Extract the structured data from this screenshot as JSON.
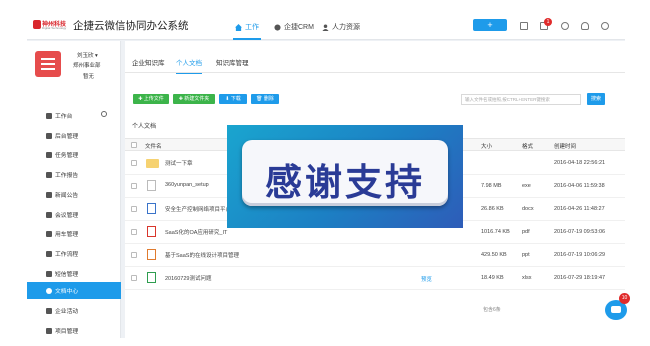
{
  "app": {
    "brand_cn": "神州科技",
    "brand_en": "Digital Technology",
    "title": "企捷云微信协同办公系统"
  },
  "nav": {
    "tabs": [
      {
        "label": "工作",
        "icon": "home-icon"
      },
      {
        "label": "企捷CRM",
        "icon": "crm-icon"
      },
      {
        "label": "人力资源",
        "icon": "people-icon"
      }
    ],
    "plus_label": "+",
    "notification_count": "1"
  },
  "user": {
    "name": "刘玉欣 ▾",
    "dept": "郑州事业部",
    "role": "暂无"
  },
  "sidebar": {
    "items": [
      {
        "label": "工作台"
      },
      {
        "label": "后台管理"
      },
      {
        "label": "任务管理"
      },
      {
        "label": "工作报告"
      },
      {
        "label": "新闻公告"
      },
      {
        "label": "会议管理"
      },
      {
        "label": "用车管理"
      },
      {
        "label": "工作流程"
      },
      {
        "label": "短信管理"
      },
      {
        "label": "文档中心"
      },
      {
        "label": "企业活动"
      },
      {
        "label": "项目管理"
      }
    ]
  },
  "content": {
    "tabs": [
      {
        "label": "企业知识库"
      },
      {
        "label": "个人文档"
      },
      {
        "label": "知识库管理"
      }
    ],
    "actions": {
      "upload": "✚ 上传文件",
      "new_folder": "✚ 新建文件夹",
      "download": "⬇ 下载",
      "delete": "🗑 删除"
    },
    "search": {
      "placeholder": "输入文件名或拍照,按CTRL+ENTER键搜索",
      "button": "搜索"
    },
    "section_title": "个人文档",
    "table": {
      "headers": {
        "name": "文件名",
        "size": "大小",
        "format": "格式",
        "created": "创建时间"
      },
      "rows": [
        {
          "name": "测试一下章",
          "action": "",
          "size": "",
          "format": "",
          "created": "2016-04-18 22:56:21",
          "icon": "folder-icon"
        },
        {
          "name": "360yunpan_setup",
          "action": "",
          "size": "7.98 MB",
          "format": "exe",
          "created": "2016-04-06 11:59:38",
          "icon": "exe-file-icon"
        },
        {
          "name": "安全生产控制网络项目平台",
          "action": "",
          "size": "26.86 KB",
          "format": "docx",
          "created": "2016-04-26 11:48:27",
          "icon": "docx-file-icon"
        },
        {
          "name": "SaaS化的OA应用研究_IT",
          "action": "",
          "size": "1016.74 KB",
          "format": "pdf",
          "created": "2016-07-19 09:53:06",
          "icon": "pdf-file-icon"
        },
        {
          "name": "基于SaaS的在线设计项目管理",
          "action": "",
          "size": "429.50 KB",
          "format": "ppt",
          "created": "2016-07-19 10:06:29",
          "icon": "ppt-file-icon"
        },
        {
          "name": "20160729测试问题",
          "action": "预览",
          "size": "18.49 KB",
          "format": "xlsx",
          "created": "2016-07-29 18:19:47",
          "icon": "xlsx-file-icon"
        }
      ],
      "total": "包含6条"
    }
  },
  "overlay": {
    "text": "感谢支持"
  },
  "chat": {
    "badge": "10"
  }
}
